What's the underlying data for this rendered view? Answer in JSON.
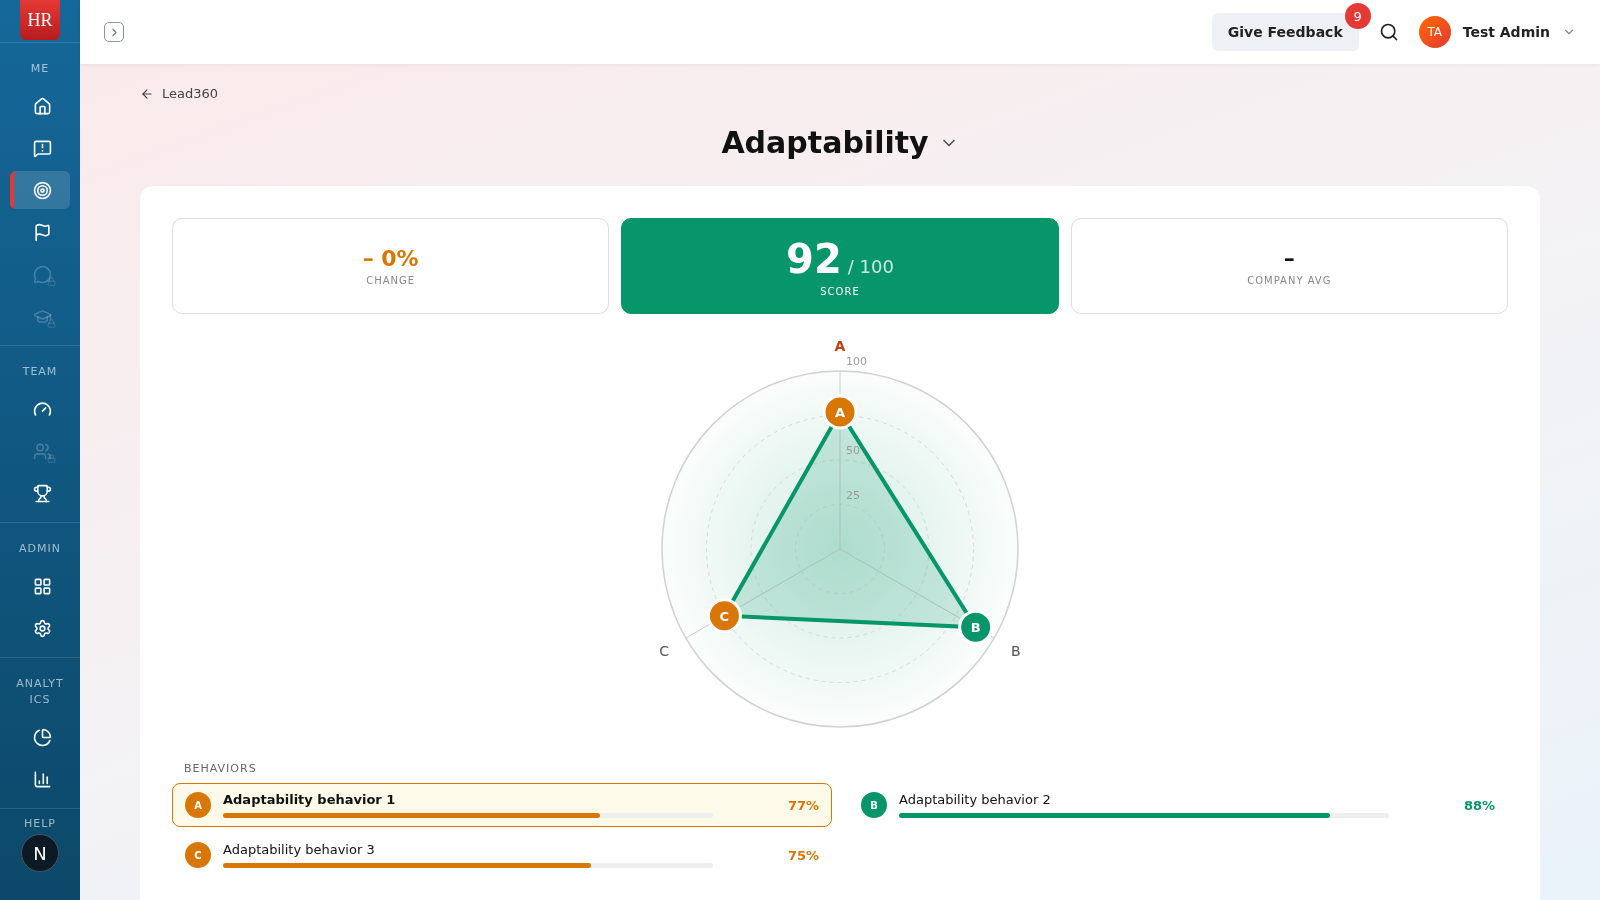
{
  "sidebar": {
    "logo": "HR",
    "sections": [
      {
        "title": "ME",
        "items": [
          {
            "selected": false,
            "disabled": false
          },
          {
            "selected": false,
            "disabled": false
          },
          {
            "selected": true,
            "disabled": false
          },
          {
            "selected": false,
            "disabled": false
          },
          {
            "selected": false,
            "disabled": true
          },
          {
            "selected": false,
            "disabled": true
          }
        ]
      },
      {
        "title": "TEAM",
        "items": [
          {
            "selected": false,
            "disabled": false
          },
          {
            "selected": false,
            "disabled": true
          },
          {
            "selected": false,
            "disabled": false
          }
        ]
      },
      {
        "title": "ADMIN",
        "items": [
          {
            "selected": false,
            "disabled": false
          },
          {
            "selected": false,
            "disabled": false
          }
        ]
      },
      {
        "title": "ANALYT ICS",
        "items": [
          {
            "selected": false,
            "disabled": false
          },
          {
            "selected": false,
            "disabled": false
          }
        ]
      }
    ],
    "help": {
      "title": "HELP",
      "avatar": "N"
    }
  },
  "topbar": {
    "feedback_button": "Give Feedback",
    "feedback_count": "9",
    "user": {
      "initials": "TA",
      "name": "Test Admin"
    }
  },
  "breadcrumb": "Lead360",
  "title": "Adaptability",
  "stats": [
    {
      "kind": "change",
      "value": "– 0%",
      "label": "CHANGE"
    },
    {
      "kind": "score",
      "value": "92",
      "suffix": "/ 100",
      "label": "SCORE"
    },
    {
      "kind": "avg",
      "value": "–",
      "label": "COMPANY AVG"
    }
  ],
  "radar": {
    "ticks": [
      "100",
      "50",
      "25"
    ],
    "axes": [
      {
        "label": "A",
        "marker": "A",
        "color": "#d97706",
        "selected": true
      },
      {
        "label": "C",
        "marker": "C",
        "color": "#d97706",
        "selected": false
      },
      {
        "label": "B",
        "marker": "B",
        "color": "#079669",
        "selected": false
      }
    ]
  },
  "behaviors_title": "BEHAVIORS",
  "behaviors": [
    {
      "letter": "A",
      "name": "Adaptability behavior 1",
      "reading": "77%",
      "level": 0.77,
      "color": "#d97706",
      "selected": true
    },
    {
      "letter": "C",
      "name": "Adaptability behavior 3",
      "reading": "75%",
      "level": 0.75,
      "color": "#d97706",
      "selected": false
    },
    {
      "letter": "B",
      "name": "Adaptability behavior 2",
      "reading": "88%",
      "level": 0.88,
      "color": "#079669",
      "selected": false
    }
  ]
}
